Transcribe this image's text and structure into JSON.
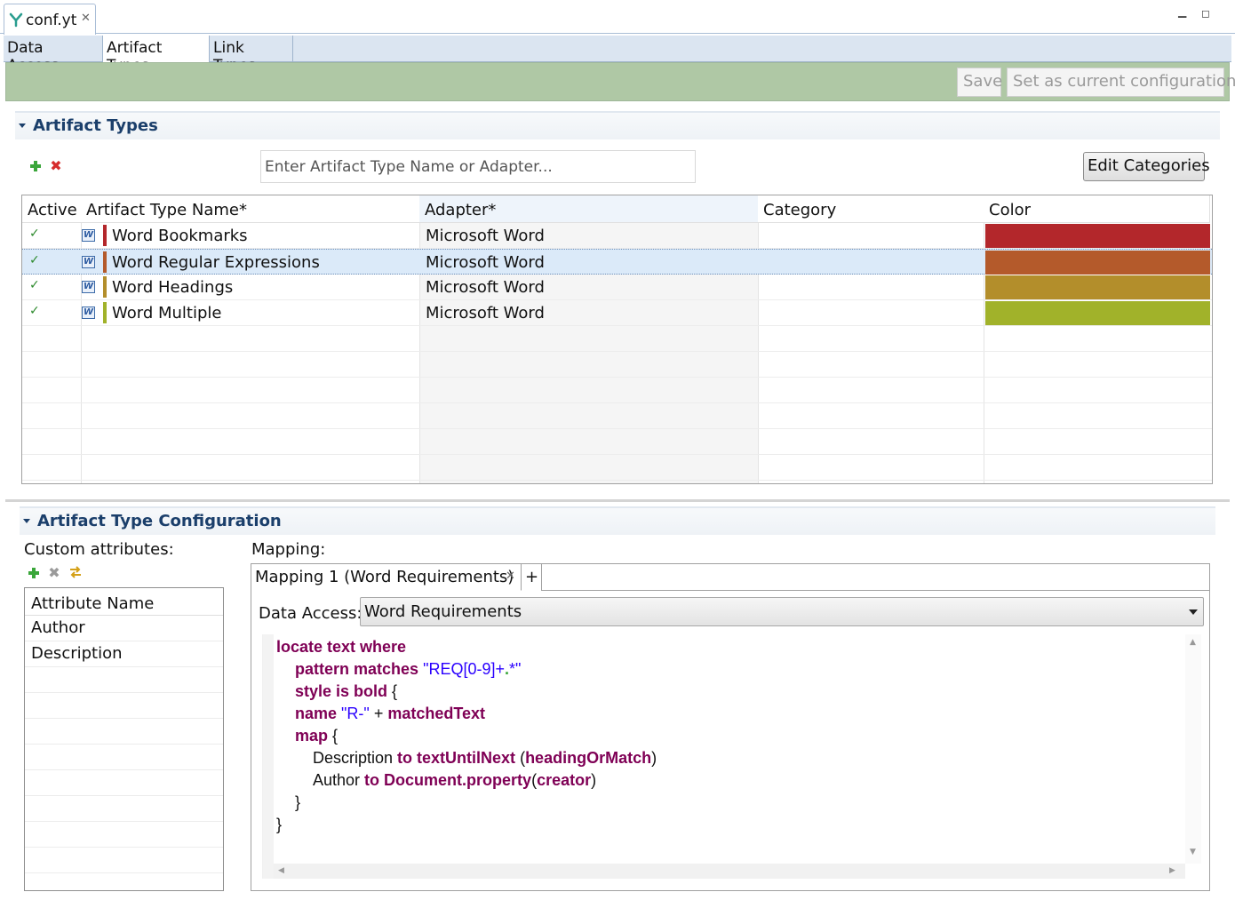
{
  "editor": {
    "tab_label": "conf.yt",
    "tab_close": "✕",
    "window_min": "▁",
    "window_max": "◻"
  },
  "page_tabs": [
    "Data Access",
    "Artifact Types",
    "Link Types"
  ],
  "toolbar": {
    "save_label": "Save",
    "set_current_label": "Set as current configuration"
  },
  "artifact_types": {
    "section_title": "Artifact Types",
    "add_icon": "plus-icon",
    "remove_icon": "remove-icon",
    "filter_placeholder": "Enter Artifact Type Name or Adapter...",
    "edit_categories_label": "Edit Categories",
    "columns": [
      "Active",
      "Artifact Type Name*",
      "Adapter*",
      "Category",
      "Color"
    ],
    "sort_indicator": "^",
    "rows": [
      {
        "active": "✓",
        "name": "Word Bookmarks",
        "adapter": "Microsoft Word",
        "category": "",
        "color": "#b3272b"
      },
      {
        "active": "✓",
        "name": "Word Regular Expressions",
        "adapter": "Microsoft Word",
        "category": "",
        "color": "#b45a2b"
      },
      {
        "active": "✓",
        "name": "Word Headings",
        "adapter": "Microsoft Word",
        "category": "",
        "color": "#b38e2b"
      },
      {
        "active": "✓",
        "name": "Word Multiple",
        "adapter": "Microsoft Word",
        "category": "",
        "color": "#a1b22a"
      }
    ],
    "word_icon_letter": "W"
  },
  "configuration": {
    "section_title": "Artifact Type Configuration",
    "custom_attributes_label": "Custom attributes:",
    "attributes_header": "Attribute Name",
    "attributes": [
      "Author",
      "Description"
    ],
    "mapping_label": "Mapping:",
    "mapping_tab": "Mapping 1 (Word Requirements)",
    "mapping_tab_close": "✕",
    "mapping_add": "+",
    "data_access_label": "Data Access:",
    "data_access_value": "Word Requirements",
    "code": {
      "l1_kw": "locate text where",
      "l2_kw": "pattern matches",
      "l2_str_a": "\"REQ[0-9]+",
      "l2_dot": ".",
      "l2_star": "*",
      "l2_str_b": "\"",
      "l3_kw": "style is bold",
      "l3_brace": " {",
      "l4_kw": "name",
      "l4_str": " \"R-\"",
      "l4_op": " + ",
      "l4_kw2": "matchedText",
      "l5_kw": "map",
      "l5_brace": " {",
      "l6_name": "Description ",
      "l6_kw": "to textUntilNext",
      "l6_p1": " (",
      "l6_kw2": "headingOrMatch",
      "l6_p2": ")",
      "l7_name": "Author ",
      "l7_kw": "to Document.property",
      "l7_p1": "(",
      "l7_kw2": "creator",
      "l7_p2": ")",
      "l8": "}",
      "l9": "}"
    }
  },
  "colors": {
    "green_toolbar": "#afc8a5",
    "section_title": "#1b3f6b",
    "keyword": "#7f0055",
    "string": "#2a00ff"
  }
}
